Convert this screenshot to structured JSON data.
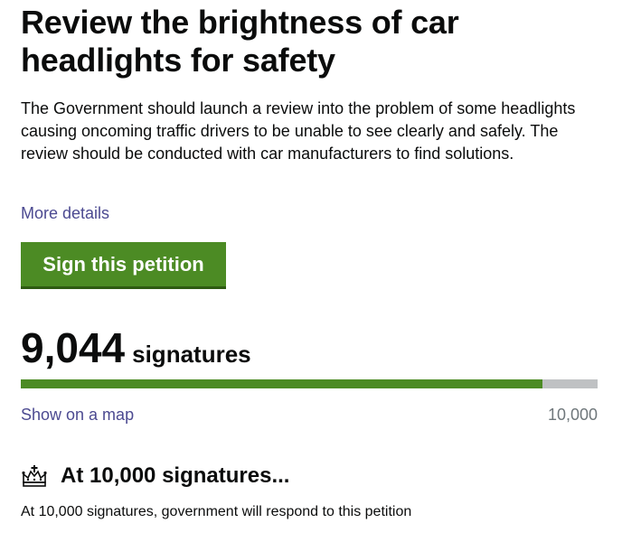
{
  "petition": {
    "title": "Review the brightness of car headlights for safety",
    "summary": "The Government should launch a review into the problem of some headlights causing oncoming traffic drivers to be unable to see clearly and safely. The review should be conducted with car manufacturers to find solutions.",
    "more_details_label": "More details",
    "sign_button_label": "Sign this petition"
  },
  "signatures": {
    "count": "9,044",
    "label": "signatures",
    "progress_fraction": 0.9044,
    "show_map_label": "Show on a map",
    "target": "10,000"
  },
  "threshold": {
    "icon": "crown-icon",
    "heading": "At 10,000 signatures...",
    "text": "At 10,000 signatures, government will respond to this petition"
  },
  "colors": {
    "button_green": "#4c8b24",
    "progress_green": "#4c8b24",
    "progress_track": "#bfc1c3",
    "link": "#4c4a91",
    "text": "#0b0c0c",
    "muted": "#6f777b"
  }
}
